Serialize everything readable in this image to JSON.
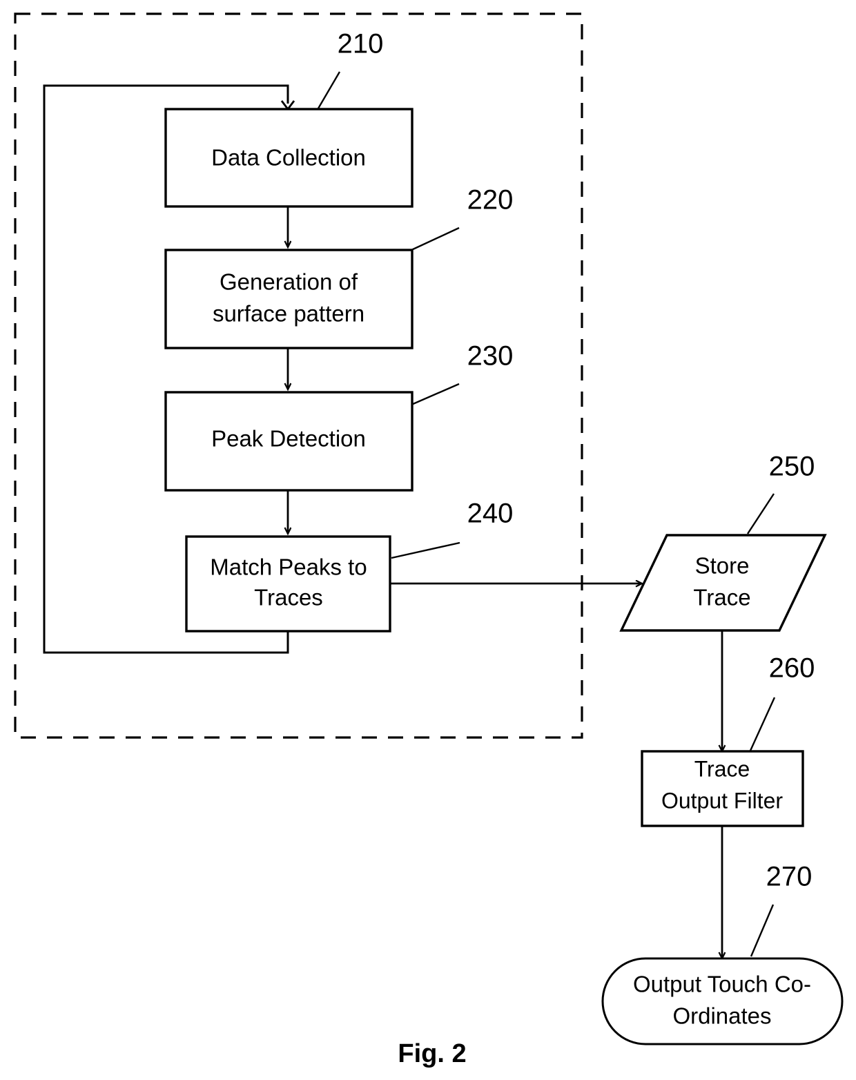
{
  "figure": {
    "caption": "Fig. 2",
    "boundary_label": "processing-loop-region"
  },
  "nodes": [
    {
      "id": "data-collection",
      "ref": "210",
      "shape": "process",
      "lines": [
        "Data Collection"
      ]
    },
    {
      "id": "generation-of-surface-pattern",
      "ref": "220",
      "shape": "process",
      "lines": [
        "Generation of",
        "surface pattern"
      ]
    },
    {
      "id": "peak-detection",
      "ref": "230",
      "shape": "process",
      "lines": [
        "Peak Detection"
      ]
    },
    {
      "id": "match-peaks-to-traces",
      "ref": "240",
      "shape": "process",
      "lines": [
        "Match Peaks to",
        "Traces"
      ]
    },
    {
      "id": "store-trace",
      "ref": "250",
      "shape": "data-parallelogram",
      "lines": [
        "Store",
        "Trace"
      ]
    },
    {
      "id": "trace-output-filter",
      "ref": "260",
      "shape": "process",
      "lines": [
        "Trace",
        "Output Filter"
      ]
    },
    {
      "id": "output-touch-coordinates",
      "ref": "270",
      "shape": "terminator",
      "lines": [
        "Output Touch Co-",
        "Ordinates"
      ]
    }
  ],
  "text": {
    "data_collection_l1": "Data Collection",
    "generation_l1": "Generation of",
    "generation_l2": "surface pattern",
    "peak_detection_l1": "Peak Detection",
    "match_peaks_l1": "Match Peaks to",
    "match_peaks_l2": "Traces",
    "store_trace_l1": "Store",
    "store_trace_l2": "Trace",
    "trace_filter_l1": "Trace",
    "trace_filter_l2": "Output Filter",
    "output_touch_l1": "Output Touch Co-",
    "output_touch_l2": "Ordinates",
    "caption": "Fig. 2"
  },
  "reference_numerals": {
    "n210": "210",
    "n220": "220",
    "n230": "230",
    "n240": "240",
    "n250": "250",
    "n260": "260",
    "n270": "270"
  },
  "colors": {
    "stroke": "#000000",
    "fill": "#ffffff",
    "background": "#ffffff"
  }
}
